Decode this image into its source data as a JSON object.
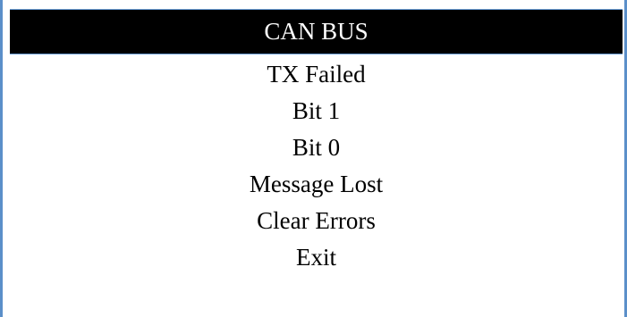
{
  "screen": {
    "title": "CAN BUS",
    "menu_items": [
      {
        "label": "TX Failed"
      },
      {
        "label": "Bit 1"
      },
      {
        "label": "Bit 0"
      },
      {
        "label": "Message Lost"
      },
      {
        "label": "Clear Errors"
      },
      {
        "label": "Exit"
      }
    ]
  },
  "colors": {
    "title_background": "#000000",
    "title_text": "#ffffff",
    "frame_accent": "#5b8fc9",
    "background": "#ffffff",
    "menu_text": "#000000"
  }
}
